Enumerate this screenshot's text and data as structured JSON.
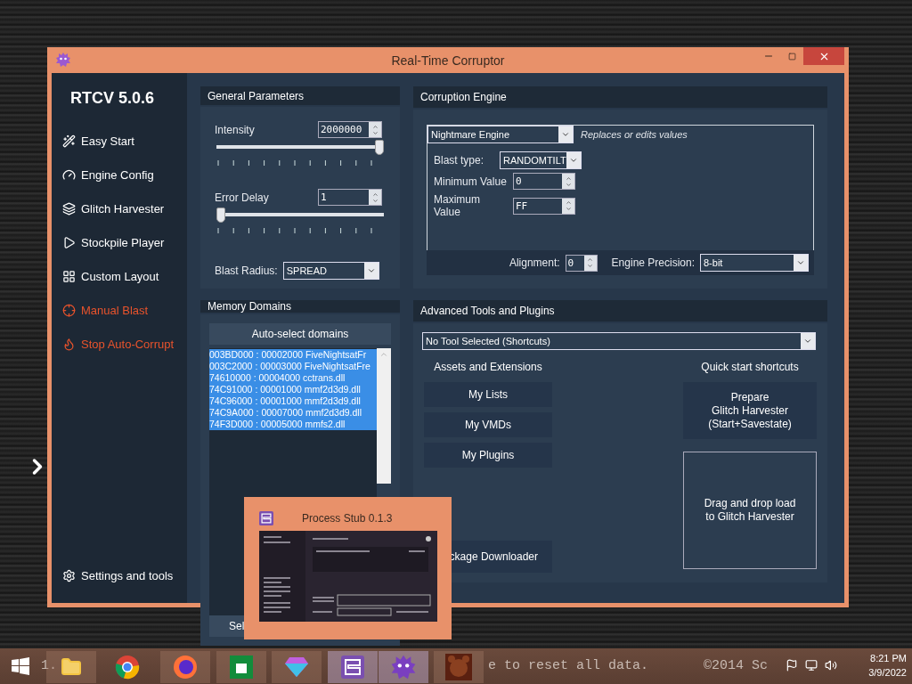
{
  "desktop": {
    "number_text": "1.",
    "background_text": "e to reset all data.",
    "copyright": "©2014 Sc"
  },
  "window": {
    "title": "Real-Time Corruptor"
  },
  "sidebar": {
    "title": "RTCV 5.0.6",
    "items": [
      {
        "label": "Easy Start",
        "color": "#ffffff"
      },
      {
        "label": "Engine Config",
        "color": "#ffffff"
      },
      {
        "label": "Glitch Harvester",
        "color": "#ffffff"
      },
      {
        "label": "Stockpile Player",
        "color": "#ffffff"
      },
      {
        "label": "Custom Layout",
        "color": "#ffffff"
      },
      {
        "label": "Manual Blast",
        "color": "#e8532c"
      },
      {
        "label": "Stop Auto-Corrupt",
        "color": "#e8532c"
      }
    ],
    "footer": "Settings and tools"
  },
  "general": {
    "title": "General Parameters",
    "intensity": {
      "label": "Intensity",
      "value": "2000000",
      "level": 1
    },
    "error_delay": {
      "label": "Error Delay",
      "value": "1",
      "level": 0
    },
    "blast_radius": {
      "label": "Blast Radius:",
      "value": "SPREAD"
    }
  },
  "engine": {
    "title": "Corruption Engine",
    "engine": "Nightmare Engine",
    "description": "Replaces or edits values",
    "blast_type": {
      "label": "Blast type:",
      "value": "RANDOMTILT"
    },
    "minimum": {
      "label": "Minimum Value",
      "value": "0"
    },
    "maximum": {
      "label": "Maximum Value",
      "value": "FF"
    },
    "alignment": {
      "label": "Alignment:",
      "value": "0"
    },
    "precision": {
      "label": "Engine Precision:",
      "value": "8-bit"
    }
  },
  "memory": {
    "title": "Memory Domains",
    "auto_button": "Auto-select domains",
    "domains": [
      {
        "text": "003BD000 : 00002000 FiveNightsatFr",
        "selected": true
      },
      {
        "text": "003C2000 : 00003000 FiveNightsatFre",
        "selected": true
      },
      {
        "text": "74610000 : 00004000 cctrans.dll",
        "selected": true
      },
      {
        "text": "74C91000 : 00001000 mmf2d3d9.dll",
        "selected": true
      },
      {
        "text": "74C96000 : 00001000 mmf2d3d9.dll",
        "selected": true
      },
      {
        "text": "74C9A000 : 00007000 mmf2d3d9.dll",
        "selected": true
      },
      {
        "text": "74F3D000 : 00005000 mmfs2.dll",
        "selected": true
      }
    ],
    "bottom_button": "Sel"
  },
  "advanced": {
    "title": "Advanced Tools and Plugins",
    "tool": "No Tool Selected (Shortcuts)",
    "assets_title": "Assets and Extensions",
    "asset_buttons": [
      "My Lists",
      "My VMDs",
      "My Plugins"
    ],
    "downloader": "ckage Downloader",
    "quick_title": "Quick start shortcuts",
    "prepare": [
      "Prepare",
      "Glitch Harvester",
      "(Start+Savestate)"
    ],
    "drop": [
      "Drag and drop load",
      "to Glitch Harvester"
    ]
  },
  "stub": {
    "title": "Process Stub 0.1.3"
  },
  "taskbar": {
    "time": "8:21 PM",
    "date": "3/9/2022"
  }
}
